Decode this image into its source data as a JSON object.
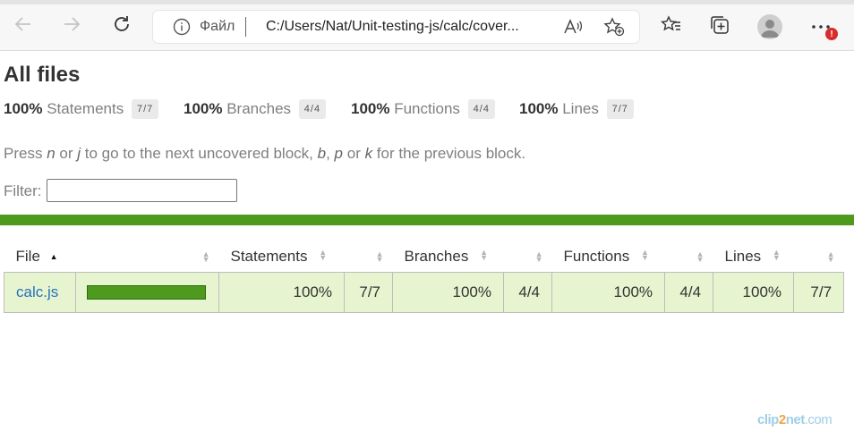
{
  "browser": {
    "scheme_label": "Файл",
    "url": "C:/Users/Nat/Unit-testing-js/calc/cover...",
    "notification_count": "!"
  },
  "page": {
    "title": "All files",
    "summary": [
      {
        "pct": "100%",
        "label": "Statements",
        "frac": "7/7"
      },
      {
        "pct": "100%",
        "label": "Branches",
        "frac": "4/4"
      },
      {
        "pct": "100%",
        "label": "Functions",
        "frac": "4/4"
      },
      {
        "pct": "100%",
        "label": "Lines",
        "frac": "7/7"
      }
    ],
    "hint": {
      "t1": "Press ",
      "k1": "n",
      "t2": " or ",
      "k2": "j",
      "t3": " to go to the next uncovered block, ",
      "k3": "b",
      "t4": ", ",
      "k4": "p",
      "t5": " or ",
      "k5": "k",
      "t6": " for the previous block."
    },
    "filter_label": "Filter:",
    "filter_value": "",
    "status_color": "#4d9a1e"
  },
  "table": {
    "headers": {
      "file": "File",
      "statements": "Statements",
      "branches": "Branches",
      "functions": "Functions",
      "lines": "Lines"
    },
    "rows": [
      {
        "file": "calc.js",
        "coverage": 1.0,
        "statements_pct": "100%",
        "statements_frac": "7/7",
        "branches_pct": "100%",
        "branches_frac": "4/4",
        "functions_pct": "100%",
        "functions_frac": "4/4",
        "lines_pct": "100%",
        "lines_frac": "7/7"
      }
    ]
  },
  "watermark": {
    "a": "clip",
    "b": "2",
    "c": "net",
    "d": ".com"
  }
}
